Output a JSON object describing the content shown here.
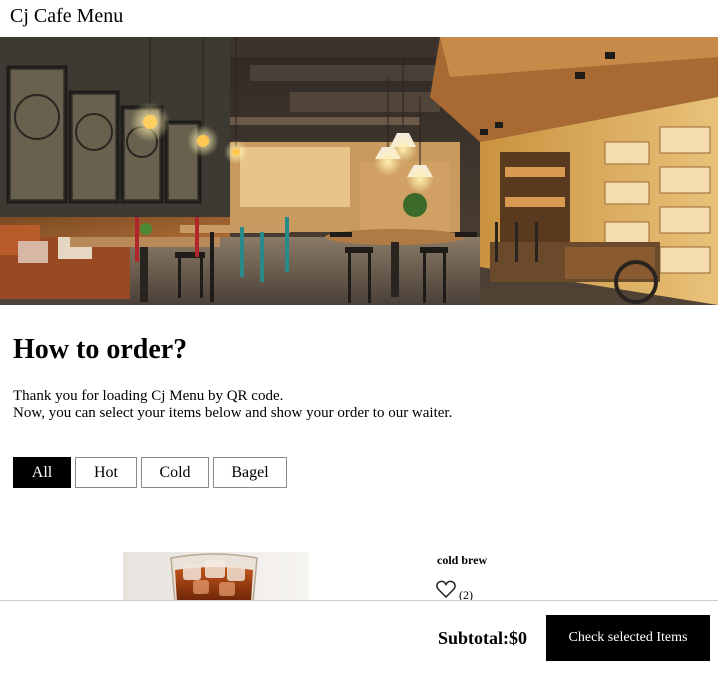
{
  "header": {
    "title": "Cj Cafe Menu"
  },
  "hero": {
    "image": "cafe-interior-photo"
  },
  "howto": {
    "heading": "How to order?",
    "line1": "Thank you for loading Cj Menu by QR code.",
    "line2": "Now, you can select your items below and show your order to our waiter."
  },
  "filters": {
    "all": "All",
    "hot": "Hot",
    "cold": "Cold",
    "bagel": "Bagel",
    "active": "All"
  },
  "items": [
    {
      "name": "cold brew",
      "likes": "(2)",
      "image": "iced-coffee-photo"
    }
  ],
  "footer": {
    "subtotal_label": "Subtotal:",
    "subtotal_value": "$0",
    "checkout_label": "Check selected Items"
  },
  "colors": {
    "primary": "#000000",
    "background": "#ffffff",
    "accent_warm": "#e8a64a"
  }
}
